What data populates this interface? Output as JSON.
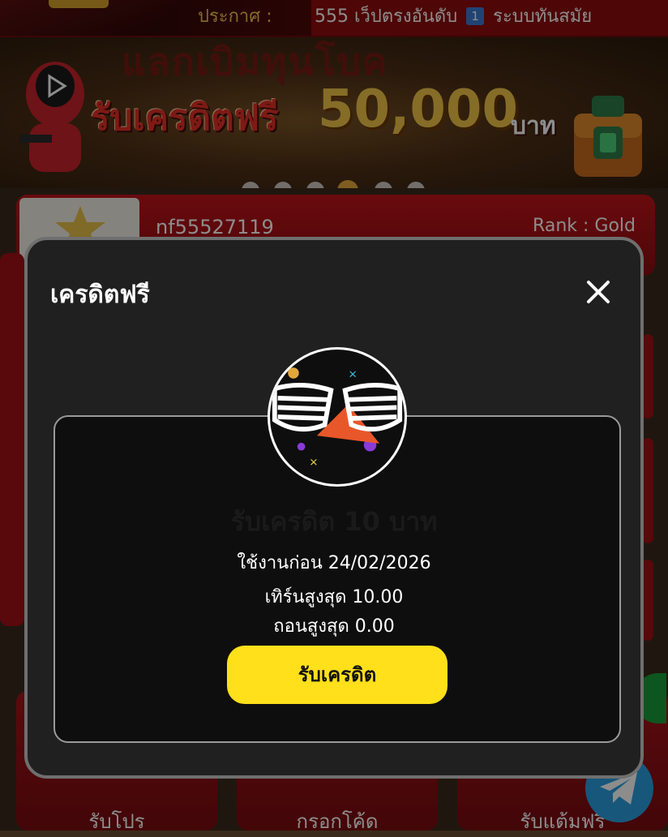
{
  "announcement": {
    "label": "ประกาศ :",
    "text_before": "555 เว็ปตรงอันดับ",
    "badge": "1",
    "text_after": "ระบบทันสมัย"
  },
  "banner": {
    "line1": "รับเครดิตฟรี",
    "amount": "50,000",
    "unit": "บาท",
    "slide_count": 6,
    "active_slide": 4
  },
  "profile": {
    "username": "nf55527119",
    "rank": "Rank : Gold"
  },
  "bottom_tiles": [
    {
      "label": "รับโปร"
    },
    {
      "label": "กรอกโค้ด"
    },
    {
      "label": "รับแต้มฟรี"
    }
  ],
  "modal": {
    "title": "เครดิตฟรี",
    "coupon": {
      "title": "รับเครดิต 10 บาท",
      "expiry": "ใช้งานก่อน 24/02/2026",
      "max_turnover": "เทิร์นสูงสุด 10.00",
      "max_withdraw": "ถอนสูงสุด 0.00",
      "claim_label": "รับเครดิต"
    }
  },
  "colors": {
    "accent_yellow": "#ffe01b",
    "brand_red": "#a20f14",
    "modal_bg": "#202020"
  },
  "icons": {
    "close": "close-icon",
    "coupon": "party-glasses-icon",
    "telegram": "telegram-icon"
  }
}
